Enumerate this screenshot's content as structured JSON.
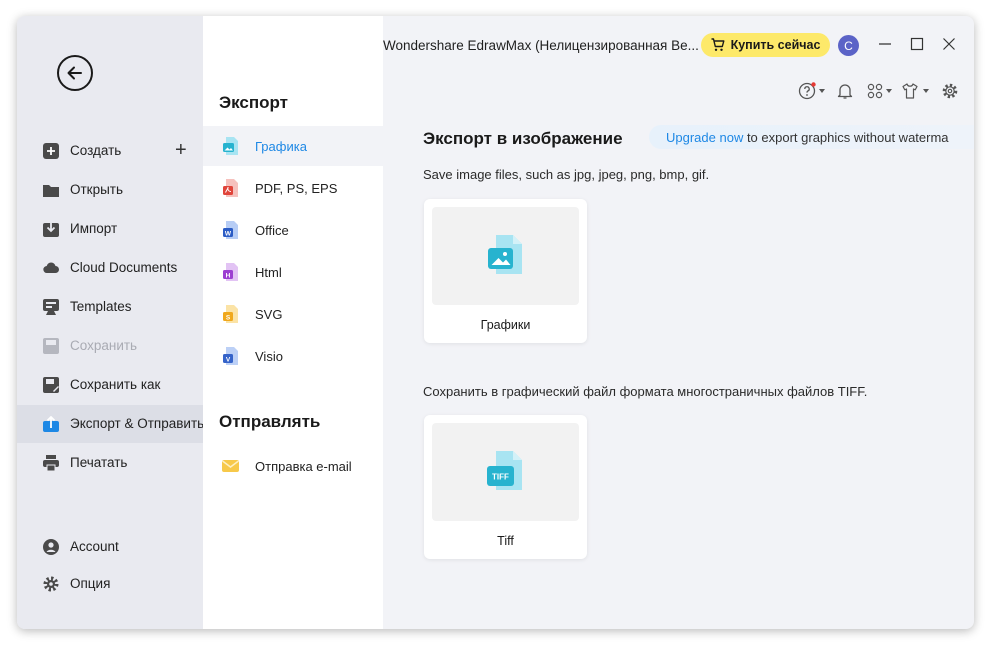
{
  "titlebar": {
    "app_title": "Wondershare EdrawMax (Нелицензированная Ве...",
    "buy_label": "Купить сейчас",
    "avatar_letter": "C"
  },
  "leftnav": {
    "items": [
      {
        "label": "Создать",
        "icon": "plus-square-icon"
      },
      {
        "label": "Открыть",
        "icon": "folder-icon"
      },
      {
        "label": "Импорт",
        "icon": "import-icon"
      },
      {
        "label": "Cloud Documents",
        "icon": "cloud-icon"
      },
      {
        "label": "Templates",
        "icon": "templates-icon"
      },
      {
        "label": "Сохранить",
        "icon": "save-icon"
      },
      {
        "label": "Сохранить как",
        "icon": "save-as-icon"
      },
      {
        "label": "Экспорт & Отправить",
        "icon": "export-icon"
      },
      {
        "label": "Печатать",
        "icon": "printer-icon"
      }
    ],
    "bottom": [
      {
        "label": "Account",
        "icon": "account-icon"
      },
      {
        "label": "Опция",
        "icon": "gear-icon"
      }
    ]
  },
  "midcol": {
    "export_title": "Экспорт",
    "export_items": [
      {
        "label": "Графика",
        "icon": "image-file-icon"
      },
      {
        "label": "PDF, PS, EPS",
        "icon": "pdf-file-icon"
      },
      {
        "label": "Office",
        "icon": "word-file-icon"
      },
      {
        "label": "Html",
        "icon": "html-file-icon"
      },
      {
        "label": "SVG",
        "icon": "svg-file-icon"
      },
      {
        "label": "Visio",
        "icon": "visio-file-icon"
      }
    ],
    "send_title": "Отправлять",
    "send_items": [
      {
        "label": "Отправка e-mail",
        "icon": "email-icon"
      }
    ]
  },
  "content": {
    "title": "Экспорт в изображение",
    "upgrade_link": "Upgrade now",
    "upgrade_text": " to export graphics without waterma",
    "desc1": "Save image files, such as jpg, jpeg, png, bmp, gif.",
    "card1_caption": "Графики",
    "desc2": "Сохранить в графический файл формата многостраничных файлов TIFF.",
    "card2_caption": "Tiff",
    "tiff_badge": "TIFF"
  },
  "colors": {
    "accent": "#1e88e5",
    "buy_button": "#fde96a",
    "avatar": "#5b63c7"
  }
}
